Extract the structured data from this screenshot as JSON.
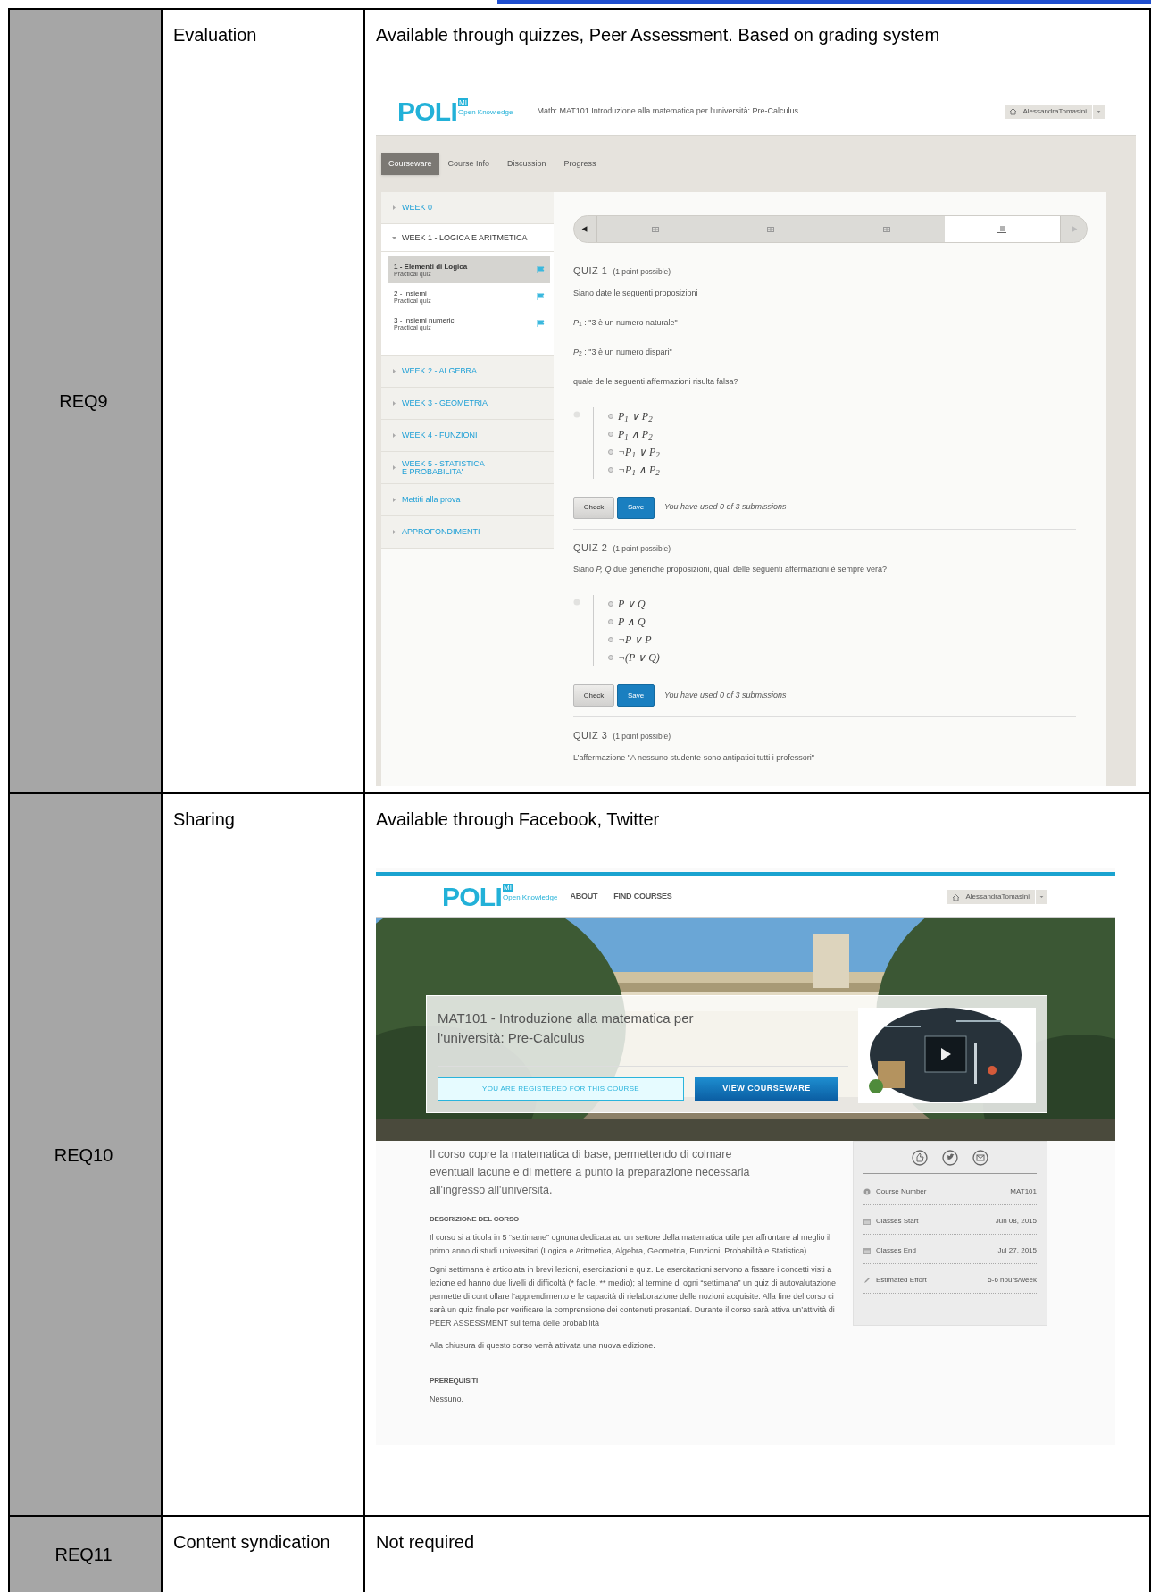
{
  "rows": [
    {
      "id": "REQ9",
      "feature": "Evaluation",
      "notes": "Available through quizzes, Peer Assessment. Based on grading system",
      "screenshot": {
        "kind": "courseware",
        "logo": {
          "text": "POLI",
          "tagline": "Open Knowledge",
          "badge": "MI"
        },
        "course_title": "Math: MAT101 Introduzione alla matematica per l'università: Pre-Calculus",
        "user": "AlessandraTomasini",
        "tabs": [
          {
            "label": "Courseware",
            "selected": true
          },
          {
            "label": "Course Info",
            "selected": false
          },
          {
            "label": "Discussion",
            "selected": false
          },
          {
            "label": "Progress",
            "selected": false
          }
        ],
        "sidebar": [
          {
            "label": "WEEK 0",
            "expanded": false
          },
          {
            "label": "WEEK 1 - LOGICA E ARITMETICA",
            "expanded": true,
            "children": [
              {
                "title": "1 - Elementi di Logica",
                "subtitle": "Practical quiz",
                "selected": true
              },
              {
                "title": "2 - Insiemi",
                "subtitle": "Practical quiz",
                "selected": false
              },
              {
                "title": "3 - Insiemi numerici",
                "subtitle": "Practical quiz",
                "selected": false
              }
            ]
          },
          {
            "label": "WEEK 2 - ALGEBRA",
            "expanded": false
          },
          {
            "label": "WEEK 3 - GEOMETRIA",
            "expanded": false
          },
          {
            "label": "WEEK 4 - FUNZIONI",
            "expanded": false
          },
          {
            "label": "WEEK 5 - STATISTICA\nE PROBABILITA'",
            "expanded": false
          },
          {
            "label": "Mettiti alla prova",
            "expanded": false
          },
          {
            "label": "APPROFONDIMENTI",
            "expanded": false
          }
        ],
        "sequence": [
          {
            "kind": "video",
            "selected": false
          },
          {
            "kind": "video",
            "selected": false
          },
          {
            "kind": "video",
            "selected": false
          },
          {
            "kind": "problem",
            "selected": true
          }
        ],
        "quizzes": [
          {
            "title": "QUIZ 1",
            "points": "(1 point possible)",
            "lines": [
              "Siano date le seguenti proposizioni",
              "*P*$_{1}$ : \"3 è un numero naturale\"",
              "*P*$_{2}$ : \"3 è un numero dispari\"",
              "quale delle seguenti affermazioni risulta falsa?"
            ],
            "options": [
              {
                "label": "P$_{1}$ ∨ P$_{2}$",
                "selected": false
              },
              {
                "label": "P$_{1}$ ∧ P$_{2}$",
                "selected": false
              },
              {
                "label": "¬P$_{1}$ ∨ P$_{2}$",
                "selected": false
              },
              {
                "label": "¬P$_{1}$ ∧ P$_{2}$",
                "selected": false
              }
            ],
            "check": "Check",
            "save": "Save",
            "submissions": "You have used 0 of 3 submissions"
          },
          {
            "title": "QUIZ 2",
            "points": "(1 point possible)",
            "lines": [
              "Siano *P, Q* due generiche proposizioni, quali delle seguenti affermazioni è sempre vera?"
            ],
            "options": [
              {
                "label": "P ∨ Q",
                "selected": false
              },
              {
                "label": "P ∧ Q",
                "selected": false
              },
              {
                "label": "¬P ∨ P",
                "selected": false
              },
              {
                "label": "¬(P ∨ Q)",
                "selected": false
              }
            ],
            "check": "Check",
            "save": "Save",
            "submissions": "You have used 0 of 3 submissions"
          },
          {
            "title": "QUIZ 3",
            "points": "(1 point possible)",
            "lines": [
              "L’affermazione \"A nessuno studente sono antipatici tutti i professori\""
            ]
          }
        ]
      }
    },
    {
      "id": "REQ10",
      "feature": "Sharing",
      "notes": "Available through Facebook, Twitter",
      "screenshot": {
        "kind": "course_about",
        "logo": {
          "text": "POLI",
          "tagline": "Open Knowledge",
          "badge": "MI"
        },
        "nav": [
          "ABOUT",
          "FIND COURSES"
        ],
        "user": "AlessandraTomasini",
        "hero": {
          "title": "MAT101 - Introduzione alla matematica per l'università: Pre-Calculus",
          "registered": "YOU ARE REGISTERED FOR THIS COURSE",
          "view": "VIEW COURSEWARE"
        },
        "intro": "Il corso copre la matematica di base, permettendo di colmare eventuali lacune e di mettere a punto la preparazione necessaria all'ingresso all'università.",
        "sections": [
          {
            "heading": "DESCRIZIONE DEL CORSO",
            "paragraphs": [
              "Il corso si articola in 5 “settimane” ognuna dedicata ad un settore della matematica utile per affrontare al meglio il primo anno di studi universitari (Logica e Aritmetica, Algebra, Geometria, Funzioni, Probabilità e Statistica).",
              "Ogni settimana è articolata in brevi lezioni, esercitazioni e quiz. Le esercitazioni servono a fissare i concetti visti a lezione ed hanno due livelli di difficoltà (* facile, ** medio); al termine di ogni “settimana” un quiz di autovalutazione permette di controllare l’apprendimento e le capacità di rielaborazione delle nozioni acquisite. Alla fine del corso ci sarà un quiz finale per verificare la comprensione dei contenuti presentati. Durante il corso sarà attiva un’attività di PEER ASSESSMENT sul tema delle probabilità",
              "Alla chiusura di questo corso verrà attivata una nuova edizione."
            ]
          },
          {
            "heading": "PREREQUISITI",
            "paragraphs": [
              "Nessuno."
            ]
          }
        ],
        "share": [
          {
            "kind": "like"
          },
          {
            "kind": "twitter"
          },
          {
            "kind": "mail"
          }
        ],
        "facts": [
          {
            "kind": "info",
            "label": "Course Number",
            "value": "MAT101"
          },
          {
            "kind": "calendar",
            "label": "Classes Start",
            "value": "Jun 08, 2015"
          },
          {
            "kind": "calendar",
            "label": "Classes End",
            "value": "Jul 27, 2015"
          },
          {
            "kind": "pencil",
            "label": "Estimated Effort",
            "value": "5-6 hours/week"
          }
        ]
      }
    },
    {
      "id": "REQ11",
      "feature": "Content syndication",
      "notes": "Not required"
    }
  ]
}
